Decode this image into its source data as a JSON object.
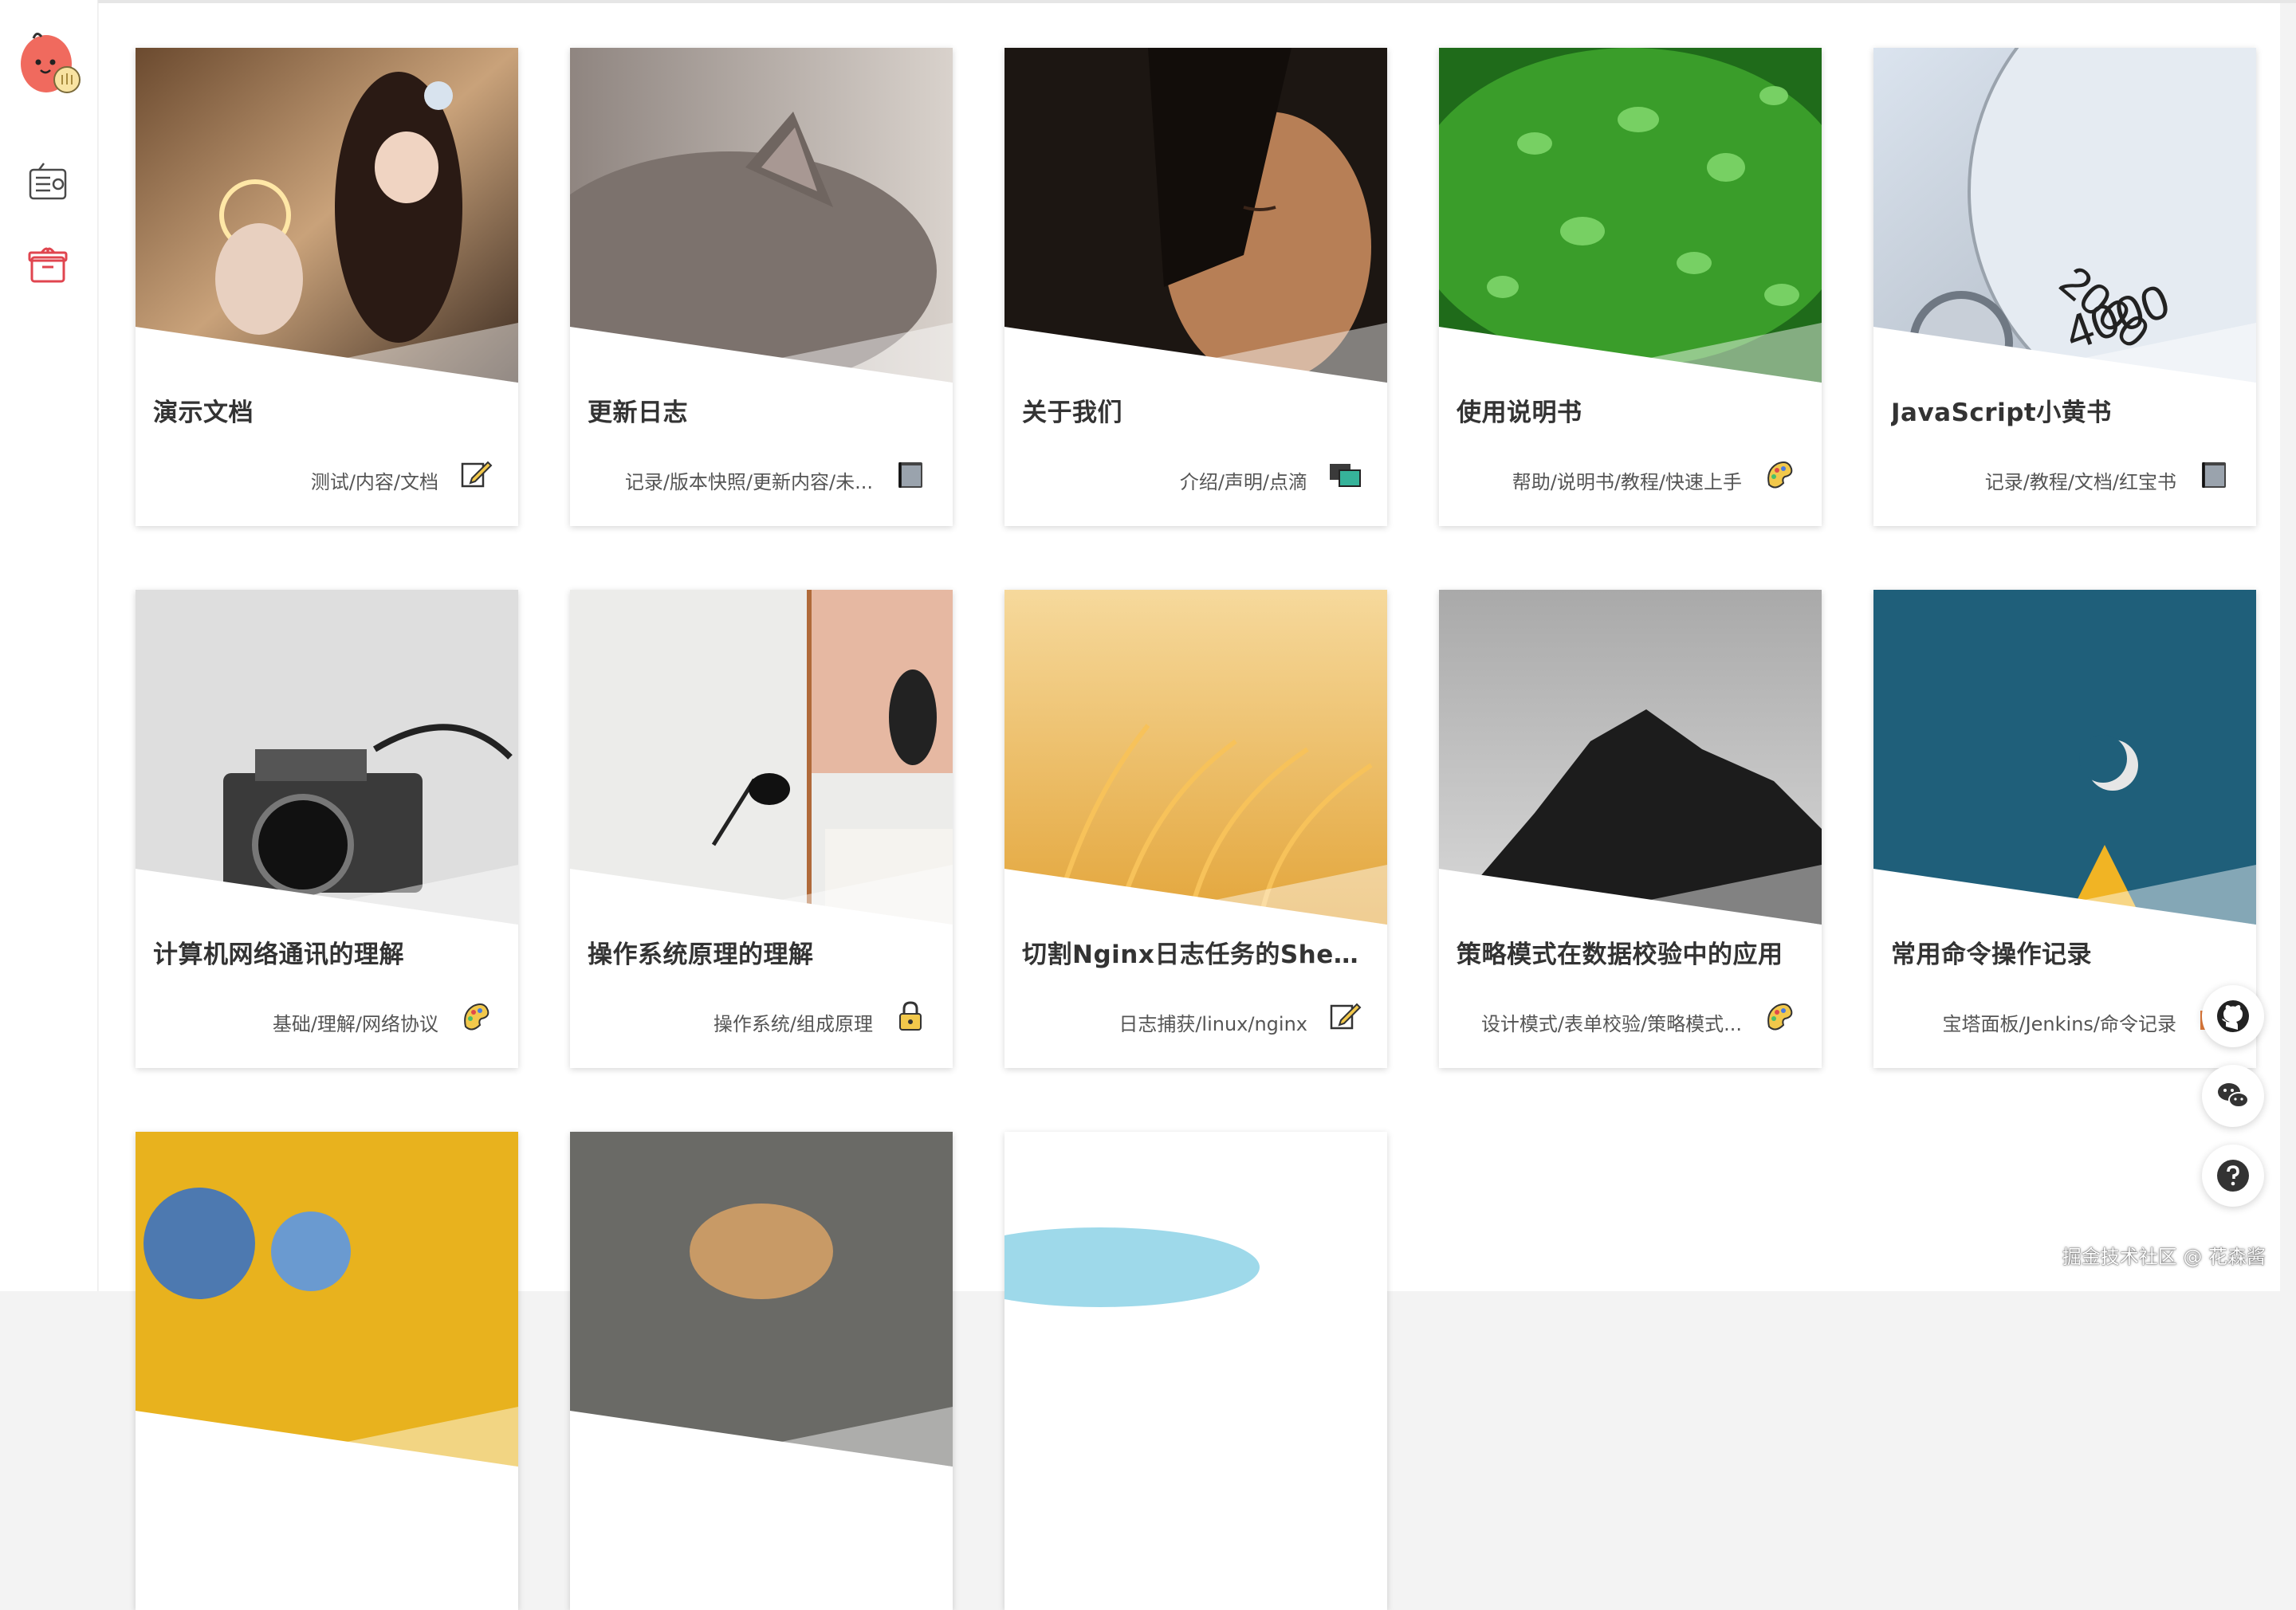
{
  "cards": [
    {
      "title": "演示文档",
      "meta": "测试/内容/文档",
      "icon": "edit-icon"
    },
    {
      "title": "更新日志",
      "meta": "记录/版本快照/更新内容/未...",
      "icon": "book-icon"
    },
    {
      "title": "关于我们",
      "meta": "介绍/声明/点滴",
      "icon": "screens-icon"
    },
    {
      "title": "使用说明书",
      "meta": "帮助/说明书/教程/快速上手",
      "icon": "palette-icon"
    },
    {
      "title": "JavaScript小黄书",
      "meta": "记录/教程/文档/红宝书",
      "icon": "book-icon"
    },
    {
      "title": "计算机网络通讯的理解",
      "meta": "基础/理解/网络协议",
      "icon": "palette-icon"
    },
    {
      "title": "操作系统原理的理解",
      "meta": "操作系统/组成原理",
      "icon": "lock-icon"
    },
    {
      "title": "切割Nginx日志任务的Shell...",
      "meta": "日志捕获/linux/nginx",
      "icon": "edit-icon"
    },
    {
      "title": "策略模式在数据校验中的应用",
      "meta": "设计模式/表单校验/策略模式...",
      "icon": "palette-icon"
    },
    {
      "title": "常用命令操作记录",
      "meta": "宝塔面板/Jenkins/命令记录",
      "icon": "tools-icon"
    },
    {
      "title": "",
      "meta": "",
      "icon": ""
    },
    {
      "title": "",
      "meta": "",
      "icon": ""
    },
    {
      "title": "",
      "meta": "",
      "icon": ""
    }
  ],
  "sidebar": {
    "items": [
      {
        "icon": "radio-icon"
      },
      {
        "icon": "gift-box-icon"
      }
    ]
  },
  "floating": [
    {
      "icon": "github-icon"
    },
    {
      "icon": "wechat-icon"
    },
    {
      "icon": "help-icon"
    }
  ],
  "watermark": "掘金技术社区 @ 花森酱",
  "colors": {
    "accent": "#e0454f",
    "text": "#333333"
  }
}
